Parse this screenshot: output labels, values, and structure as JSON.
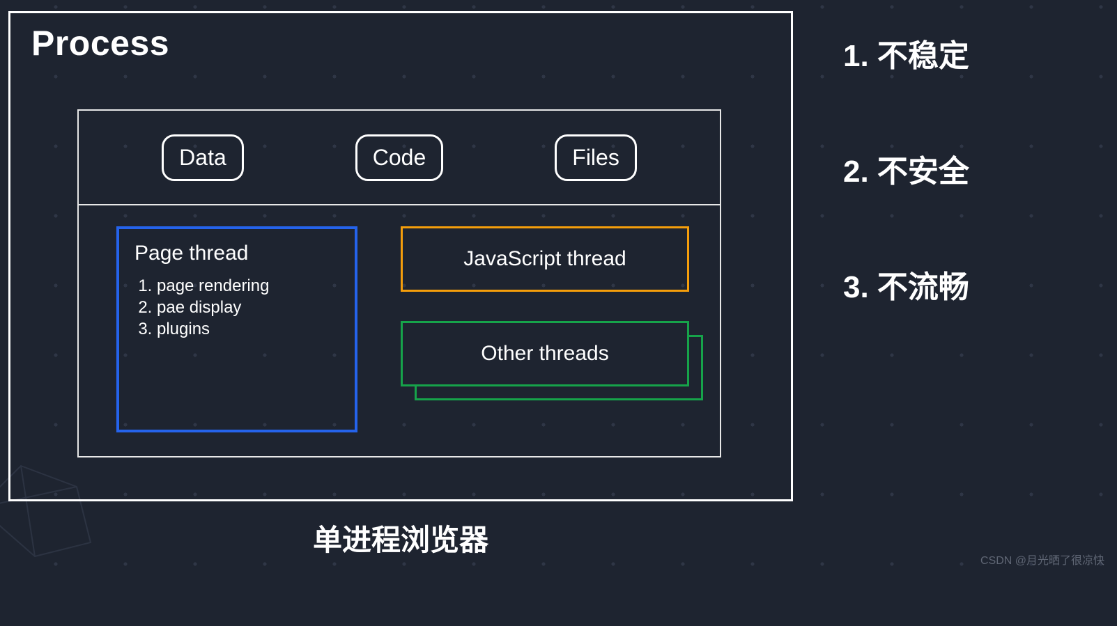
{
  "process": {
    "title": "Process",
    "resources": [
      "Data",
      "Code",
      "Files"
    ],
    "page_thread": {
      "title": "Page thread",
      "items": [
        "page rendering",
        "pae display",
        "plugins"
      ]
    },
    "js_thread": "JavaScript thread",
    "other_threads": "Other threads"
  },
  "problems": [
    "1. 不稳定",
    "2. 不安全",
    "3. 不流畅"
  ],
  "caption": "单进程浏览器",
  "watermark": "CSDN @月光晒了很凉快",
  "colors": {
    "background": "#1e2430",
    "border_white": "#ffffff",
    "border_blue": "#2563eb",
    "border_orange": "#f59e0b",
    "border_green": "#16a34a"
  }
}
